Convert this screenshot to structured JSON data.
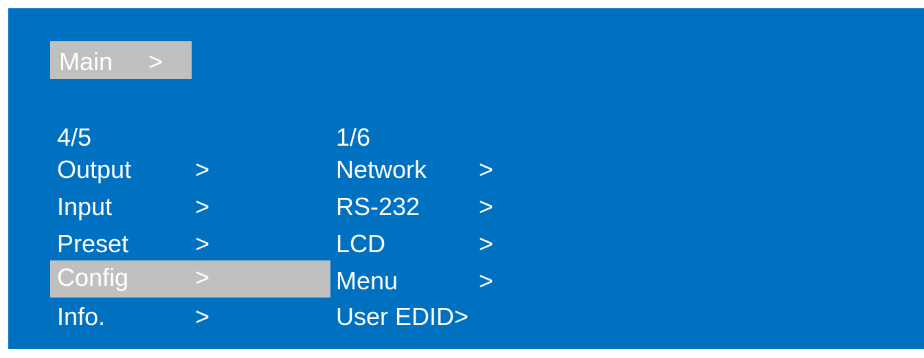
{
  "breadcrumb": {
    "label": "Main",
    "arrow": ">"
  },
  "menu_left": {
    "counter": "4/5",
    "items": [
      {
        "label": "Output",
        "arrow": ">"
      },
      {
        "label": "Input",
        "arrow": ">"
      },
      {
        "label": "Preset",
        "arrow": ">"
      },
      {
        "label": "Config",
        "arrow": ">"
      },
      {
        "label": "Info.",
        "arrow": ">"
      }
    ]
  },
  "menu_right": {
    "counter": "1/6",
    "items": [
      {
        "label": "Network",
        "arrow": ">"
      },
      {
        "label": "RS-232",
        "arrow": ">"
      },
      {
        "label": "LCD",
        "arrow": ">"
      },
      {
        "label": "Menu",
        "arrow": ">"
      },
      {
        "label": "User EDID>"
      }
    ]
  },
  "colors": {
    "background": "#0070c0",
    "highlight": "#c0c0c0",
    "text": "#ffffff"
  }
}
